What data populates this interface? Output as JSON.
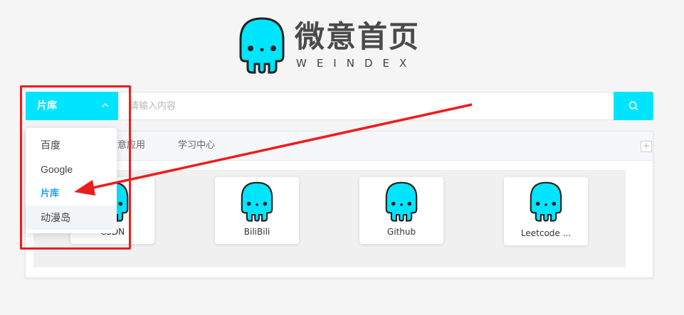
{
  "logo": {
    "title": "微意首页",
    "subtitle": "WEINDEX",
    "mascot_color": "#00e5ff"
  },
  "search": {
    "engine_selected": "片库",
    "placeholder": "请输入内容",
    "value": "",
    "accent_color": "#00e5ff",
    "search_icon": "search-icon",
    "chevron_icon": "chevron-up-icon"
  },
  "engine_dropdown": {
    "items": [
      {
        "label": "百度",
        "state": "normal"
      },
      {
        "label": "Google",
        "state": "normal"
      },
      {
        "label": "片库",
        "state": "selected"
      },
      {
        "label": "动漫岛",
        "state": "hover"
      }
    ]
  },
  "tabs": {
    "items": [
      {
        "label": "微意应用"
      },
      {
        "label": "学习中心"
      }
    ],
    "add_label": "+"
  },
  "cards": {
    "items": [
      {
        "label": "CSDN"
      },
      {
        "label": "BiliBili"
      },
      {
        "label": "Github"
      },
      {
        "label": "Leetcode ..."
      }
    ]
  },
  "annotation": {
    "color": "#ee1c1c"
  }
}
